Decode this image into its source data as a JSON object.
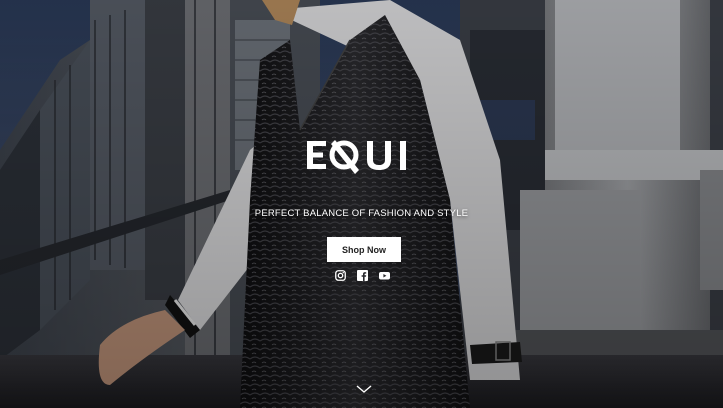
{
  "brand": {
    "logo_text": "EQUI"
  },
  "hero": {
    "tagline": "PERFECT BALANCE OF FASHION AND STYLE",
    "cta_label": "Shop Now"
  },
  "social": [
    {
      "icon": "instagram-icon"
    },
    {
      "icon": "facebook-icon"
    },
    {
      "icon": "youtube-icon"
    }
  ],
  "colors": {
    "text": "#ffffff",
    "button_bg": "#ffffff",
    "button_text": "#222222"
  }
}
